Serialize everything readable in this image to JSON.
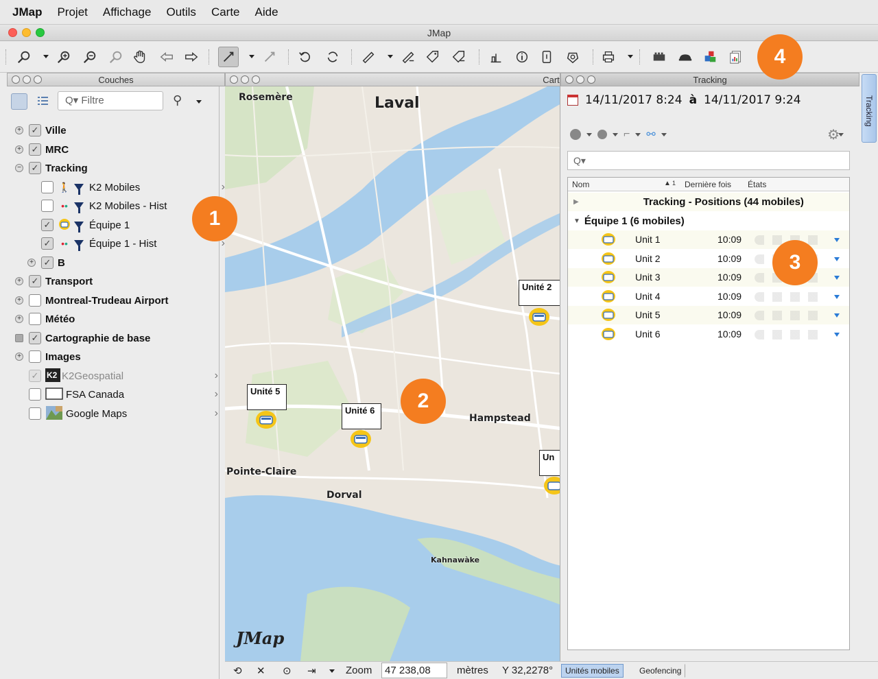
{
  "menubar": {
    "items": [
      "JMap",
      "Projet",
      "Affichage",
      "Outils",
      "Carte",
      "Aide"
    ]
  },
  "window": {
    "title": "JMap"
  },
  "badges": [
    "1",
    "2",
    "3",
    "4"
  ],
  "layers_panel": {
    "title": "Couches",
    "filter_placeholder": "Filtre",
    "items": [
      {
        "label": "Ville",
        "checked": true,
        "bold": true
      },
      {
        "label": "MRC",
        "checked": true,
        "bold": true
      },
      {
        "label": "Tracking",
        "checked": true,
        "bold": true
      },
      {
        "label": "K2 Mobiles",
        "checked": false
      },
      {
        "label": "K2 Mobiles - Hist",
        "checked": false
      },
      {
        "label": "Équipe 1",
        "checked": true
      },
      {
        "label": "Équipe 1 - Hist",
        "checked": true
      },
      {
        "label": "B",
        "checked": true,
        "bold": true
      },
      {
        "label": "Transport",
        "checked": true,
        "bold": true
      },
      {
        "label": "Montreal-Trudeau Airport",
        "checked": false,
        "bold": true
      },
      {
        "label": "Météo",
        "checked": false,
        "bold": true
      },
      {
        "label": "Cartographie de base",
        "checked": true,
        "bold": true
      },
      {
        "label": "Images",
        "checked": false,
        "bold": true
      },
      {
        "label": "K2Geospatial",
        "checked": true
      },
      {
        "label": "FSA Canada",
        "checked": false
      },
      {
        "label": "Google Maps",
        "checked": false
      }
    ]
  },
  "map_panel": {
    "title": "Carte",
    "labels": {
      "rosemere": "Rosemère",
      "laval": "Laval",
      "hampstead": "Hampstead",
      "pointe_claire": "Pointe-Claire",
      "dorval": "Dorval",
      "kahnawake": "Kahnawàke"
    },
    "units": {
      "unit5": "Unité 5",
      "unit6": "Unité 6",
      "unit2": "Unité 2",
      "unit_partial": "Un"
    },
    "logo": "JMap"
  },
  "status": {
    "zoom_label": "Zoom",
    "zoom_value": "47 238,08",
    "units": "mètres",
    "coord": "Y 32,2278°",
    "tab_mobiles": "Unités mobiles",
    "tab_geofencing": "Geofencing"
  },
  "tracking_panel": {
    "title": "Tracking",
    "date_from": "14/11/2017  8:24",
    "date_sep": "à",
    "date_to": "14/11/2017  9:24",
    "columns": {
      "name": "Nom",
      "sort": "1",
      "last": "Dernière fois",
      "state": "États"
    },
    "group_all": "Tracking - Positions (44 mobiles)",
    "group_team": "Équipe 1 (6 mobiles)",
    "rows": [
      {
        "name": "Unit 1",
        "time": "10:09"
      },
      {
        "name": "Unit 2",
        "time": "10:09"
      },
      {
        "name": "Unit 3",
        "time": "10:09"
      },
      {
        "name": "Unit 4",
        "time": "10:09"
      },
      {
        "name": "Unit 5",
        "time": "10:09"
      },
      {
        "name": "Unit 6",
        "time": "10:09"
      }
    ],
    "side_tab": "Tracking"
  }
}
